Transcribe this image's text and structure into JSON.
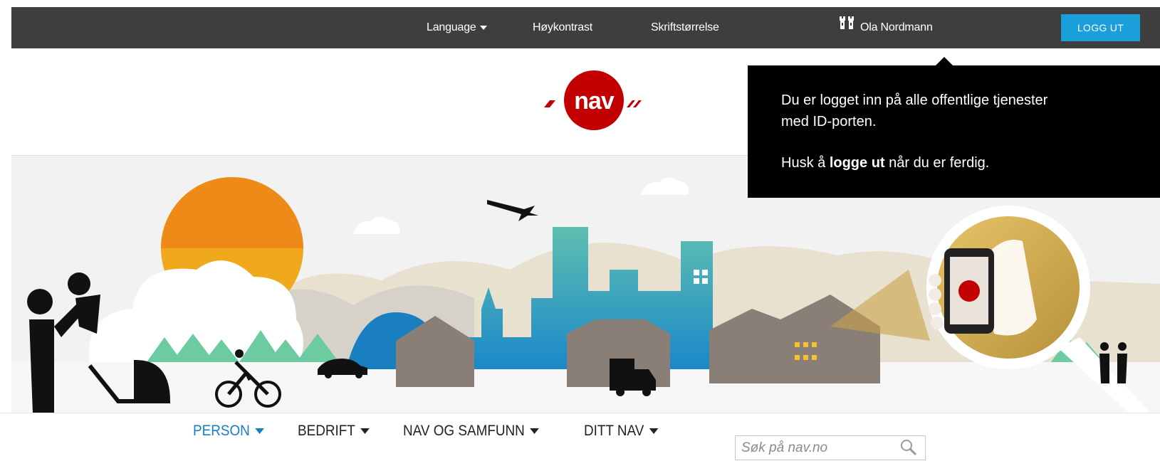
{
  "topbar": {
    "language_label": "Language",
    "high_contrast_label": "Høykontrast",
    "font_size_label": "Skriftstørrelse",
    "user_name": "Ola Nordmann",
    "logout_label": "LOGG UT"
  },
  "logo": {
    "text": "nav"
  },
  "tooltip": {
    "line1": "Du er logget inn på alle offentlige tjenester",
    "line2": "med ID-porten.",
    "line3_pre": "Husk å ",
    "line3_bold": "logge ut",
    "line3_post": " når du er ferdig."
  },
  "nav": {
    "items": [
      {
        "label": "PERSON"
      },
      {
        "label": "BEDRIFT"
      },
      {
        "label": "NAV OG SAMFUNN"
      },
      {
        "label": "DITT NAV"
      }
    ]
  },
  "search": {
    "placeholder": "Søk på nav.no"
  },
  "colors": {
    "topbar_bg": "#3e3e3e",
    "accent_blue": "#1a9fdb",
    "nav_active": "#1a7ec2",
    "logo_red": "#c30000"
  }
}
